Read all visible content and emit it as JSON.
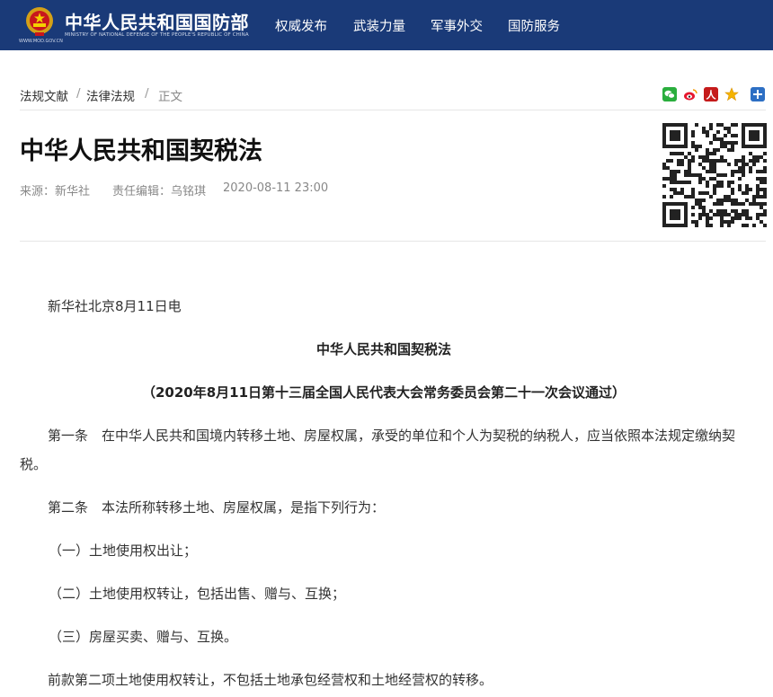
{
  "header": {
    "logo_cn": "中华人民共和国国防部",
    "logo_en": "MINISTRY OF NATIONAL DEFENSE OF THE PEOPLE'S REPUBLIC OF CHINA",
    "logo_url": "WWW.MOD.GOV.CN",
    "nav": [
      "权威发布",
      "武装力量",
      "军事外交",
      "国防服务"
    ],
    "bg_color": "#1a3a78"
  },
  "breadcrumb": [
    "法规文献",
    "法律法规",
    "正文"
  ],
  "share_icons": [
    "wechat-icon",
    "weibo-icon",
    "people-icon",
    "star-icon",
    "more-icon"
  ],
  "article": {
    "title": "中华人民共和国契税法",
    "source": "来源：新华社",
    "editor": "责任编辑：乌铭琪",
    "date": "2020-08-11 23:00",
    "dateline": "新华社北京8月11日电",
    "law_title": "中华人民共和国契税法",
    "law_subtitle": "（2020年8月11日第十三届全国人民代表大会常务委员会第二十一次会议通过）",
    "art1": "第一条　在中华人民共和国境内转移土地、房屋权属，承受的单位和个人为契税的纳税人，应当依照本法规定缴纳契税。",
    "art2": "第二条　本法所称转移土地、房屋权属，是指下列行为：",
    "items": [
      "（一）土地使用权出让；",
      "（二）土地使用权转让，包括出售、赠与、互换；",
      "（三）房屋买卖、赠与、互换。"
    ],
    "note": "前款第二项土地使用权转让，不包括土地承包经营权和土地经营权的转移。"
  }
}
